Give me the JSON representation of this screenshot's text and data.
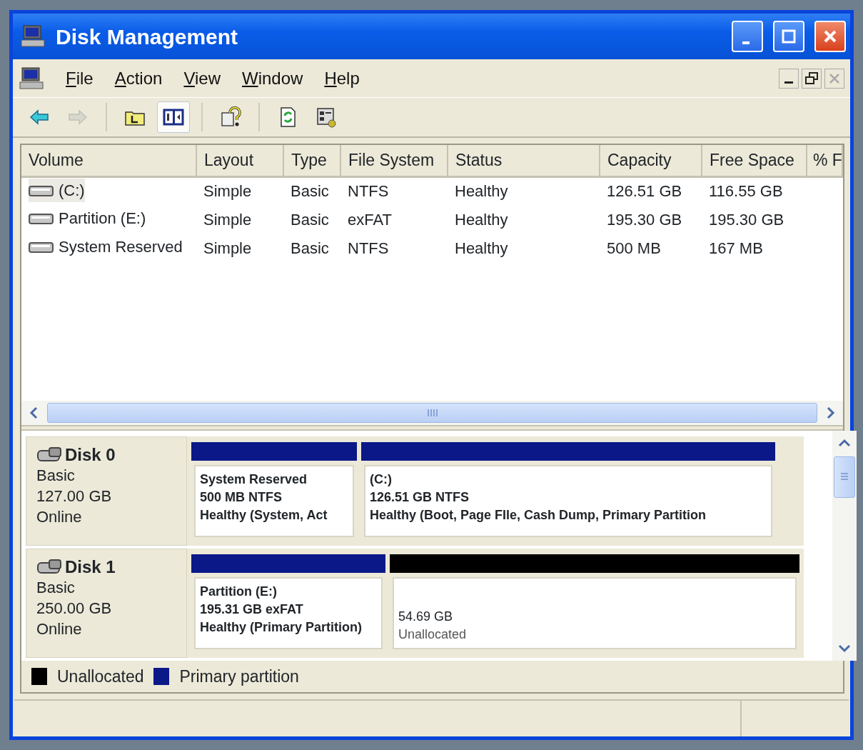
{
  "window": {
    "title": "Disk Management"
  },
  "menu": [
    {
      "label": "File"
    },
    {
      "label": "Action"
    },
    {
      "label": "View"
    },
    {
      "label": "Window"
    },
    {
      "label": "Help"
    }
  ],
  "mdi_controls": [
    {
      "kind": "minimize",
      "disabled": false
    },
    {
      "kind": "restore",
      "disabled": false
    },
    {
      "kind": "close",
      "disabled": true
    }
  ],
  "toolbar": [
    {
      "kind": "back",
      "disabled": false,
      "selected": false
    },
    {
      "kind": "forward",
      "disabled": true,
      "selected": false
    },
    {
      "kind": "up",
      "disabled": false,
      "selected": false
    },
    {
      "kind": "tree",
      "disabled": false,
      "selected": true
    },
    {
      "kind": "help",
      "disabled": false,
      "selected": false
    },
    {
      "kind": "refresh",
      "disabled": false,
      "selected": false
    },
    {
      "kind": "properties",
      "disabled": false,
      "selected": false
    }
  ],
  "volume_table": {
    "columns": [
      "Volume",
      "Layout",
      "Type",
      "File System",
      "Status",
      "Capacity",
      "Free Space",
      "% F"
    ],
    "rows": [
      {
        "volume": "(C:)",
        "layout": "Simple",
        "type": "Basic",
        "file_system": "NTFS",
        "status": "Healthy",
        "capacity": "126.51 GB",
        "free_space": "116.55 GB",
        "selected": true
      },
      {
        "volume": "Partition (E:)",
        "layout": "Simple",
        "type": "Basic",
        "file_system": "exFAT",
        "status": "Healthy",
        "capacity": "195.30 GB",
        "free_space": "195.30 GB",
        "selected": false
      },
      {
        "volume": "System Reserved",
        "layout": "Simple",
        "type": "Basic",
        "file_system": "NTFS",
        "status": "Healthy",
        "capacity": "500 MB",
        "free_space": "167 MB",
        "selected": false
      }
    ]
  },
  "disks": [
    {
      "name": "Disk 0",
      "type": "Basic",
      "size": "127.00 GB",
      "status": "Online",
      "partitions": [
        {
          "kind": "primary",
          "lines": [
            "System Reserved",
            "500 MB NTFS",
            "Healthy (System, Act"
          ]
        },
        {
          "kind": "primary",
          "lines": [
            "(C:)",
            "126.51 GB NTFS",
            "Healthy (Boot, Page FIle, Cash Dump, Primary Partition"
          ]
        }
      ]
    },
    {
      "name": "Disk 1",
      "type": "Basic",
      "size": "250.00 GB",
      "status": "Online",
      "partitions": [
        {
          "kind": "primary",
          "lines": [
            "Partition (E:)",
            "195.31 GB exFAT",
            "Healthy (Primary Partition)"
          ]
        },
        {
          "kind": "unallocated",
          "lines": [
            "54.69 GB",
            "Unallocated"
          ]
        }
      ]
    }
  ],
  "legend": [
    {
      "kind": "unallocated",
      "label": "Unallocated"
    },
    {
      "kind": "primary",
      "label": "Primary partition"
    }
  ]
}
